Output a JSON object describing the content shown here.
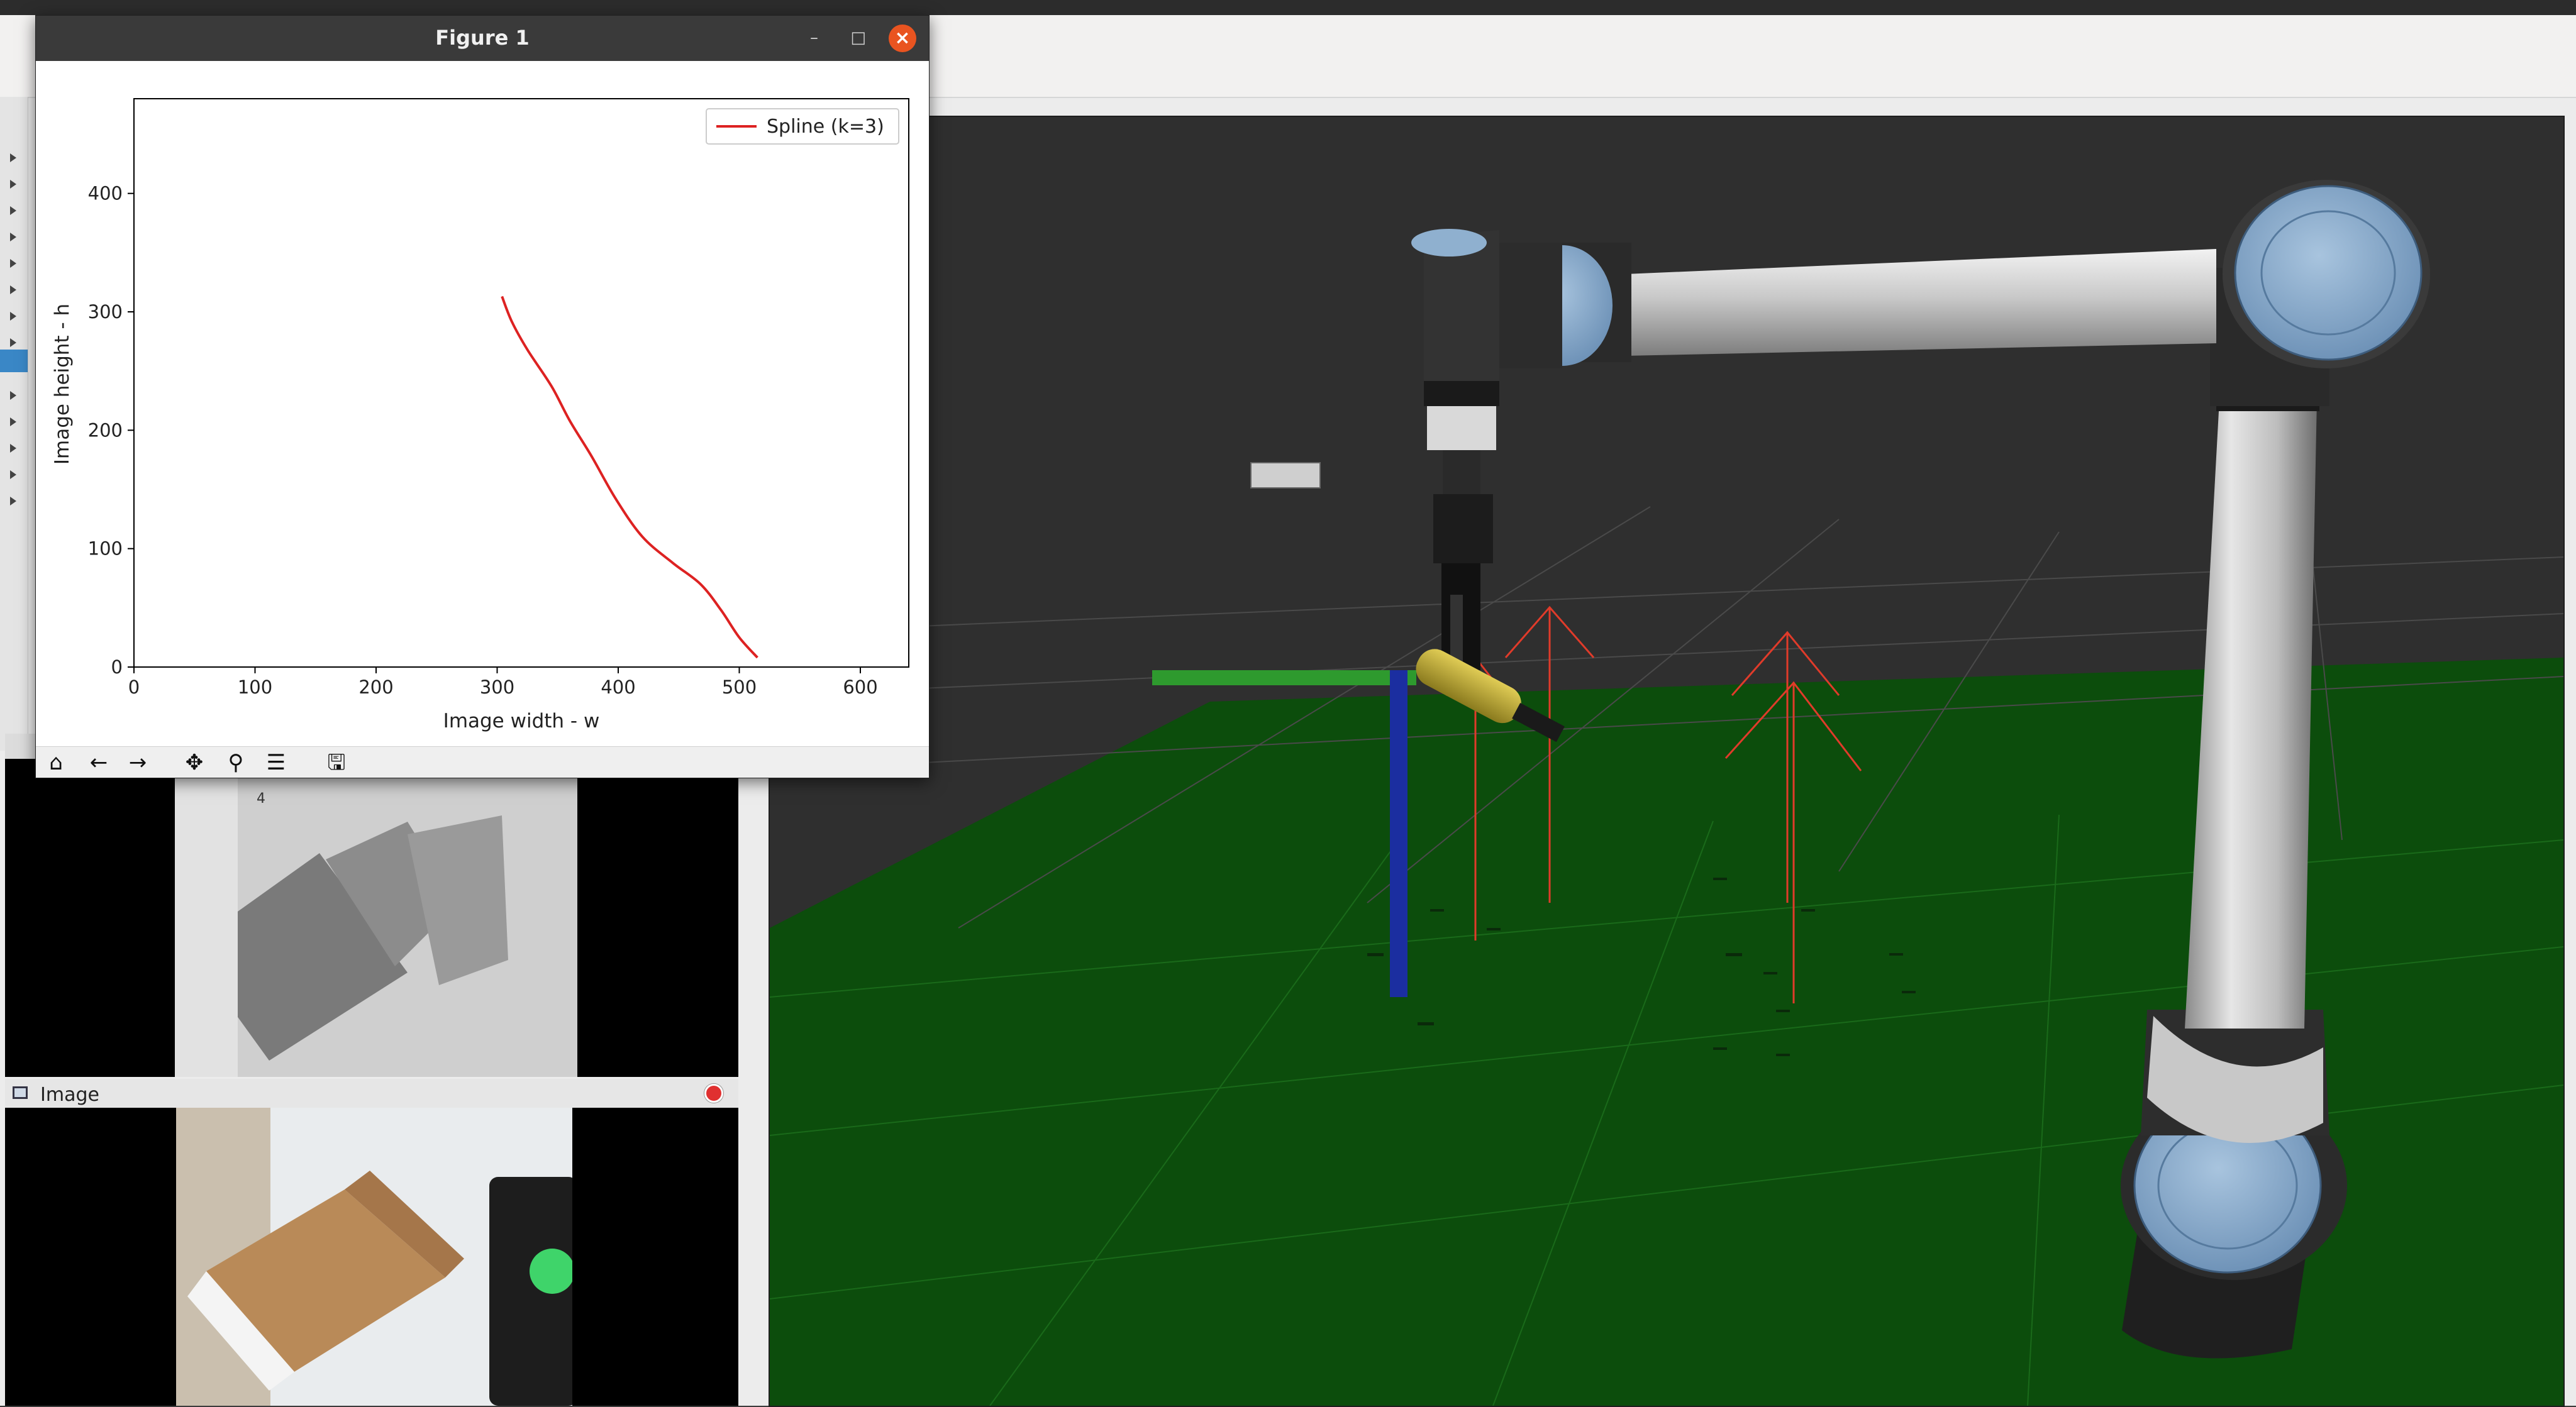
{
  "figure_window": {
    "title": "Figure 1",
    "controls": {
      "minimize": "–",
      "maximize": "□",
      "close": "×"
    },
    "toolbar": [
      {
        "name": "home",
        "glyph": "⌂"
      },
      {
        "name": "back",
        "glyph": "←"
      },
      {
        "name": "forward",
        "glyph": "→"
      },
      {
        "name": "pan",
        "glyph": "✥"
      },
      {
        "name": "zoom",
        "glyph": "⚲"
      },
      {
        "name": "configure-subplots",
        "glyph": "☰"
      },
      {
        "name": "save",
        "glyph": "🖫"
      }
    ]
  },
  "image_panels": {
    "depth": {
      "tab_marker": "4"
    },
    "color": {
      "title": "Image"
    }
  },
  "colors": {
    "spline": "#dd2222",
    "ground": "#0c4d0c",
    "robot_joint": "#8fb0cf",
    "axis_x": "#2e9a2e",
    "axis_z": "#1b2ea0",
    "arrows": "#e03b2a"
  },
  "chart_data": {
    "type": "line",
    "title": "",
    "xlabel": "Image width  - w",
    "ylabel": "Image height - h",
    "xlim": [
      0,
      640
    ],
    "ylim": [
      0,
      480
    ],
    "xticks": [
      0,
      100,
      200,
      300,
      400,
      500,
      600
    ],
    "yticks": [
      0,
      100,
      200,
      300,
      400
    ],
    "grid": false,
    "legend": "top-right",
    "series": [
      {
        "name": "Spline (k=3)",
        "color": "#dd2222",
        "x": [
          304,
          312,
          325,
          345,
          360,
          378,
          398,
          420,
          445,
          468,
          485,
          500,
          515
        ],
        "y": [
          313,
          292,
          268,
          237,
          208,
          178,
          142,
          110,
          88,
          70,
          48,
          25,
          8
        ]
      }
    ]
  }
}
